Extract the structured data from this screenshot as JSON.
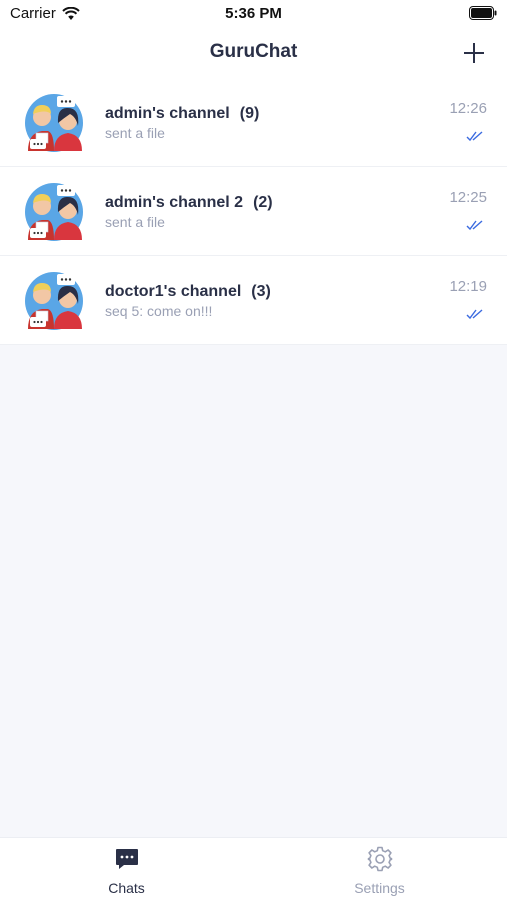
{
  "status_bar": {
    "carrier": "Carrier",
    "time": "5:36 PM"
  },
  "nav": {
    "title": "GuruChat",
    "add_icon": "plus-icon"
  },
  "chats": [
    {
      "name": "admin's channel",
      "count": "(9)",
      "preview": "sent a file",
      "time": "12:26",
      "status_icon": "double-check-icon"
    },
    {
      "name": "admin's channel 2",
      "count": "(2)",
      "preview": "sent a file",
      "time": "12:25",
      "status_icon": "double-check-icon"
    },
    {
      "name": "doctor1's channel",
      "count": "(3)",
      "preview": "seq 5: come on!!!",
      "time": "12:19",
      "status_icon": "double-check-icon"
    }
  ],
  "tabs": [
    {
      "label": "Chats",
      "icon": "chat-bubble-icon",
      "active": true
    },
    {
      "label": "Settings",
      "icon": "gear-icon",
      "active": false
    }
  ],
  "colors": {
    "text_primary": "#2a3047",
    "text_secondary": "#9aa0b4",
    "accent_check": "#3b6be0",
    "background": "#f6f7fb",
    "avatar_bg": "#5aa6e6"
  }
}
